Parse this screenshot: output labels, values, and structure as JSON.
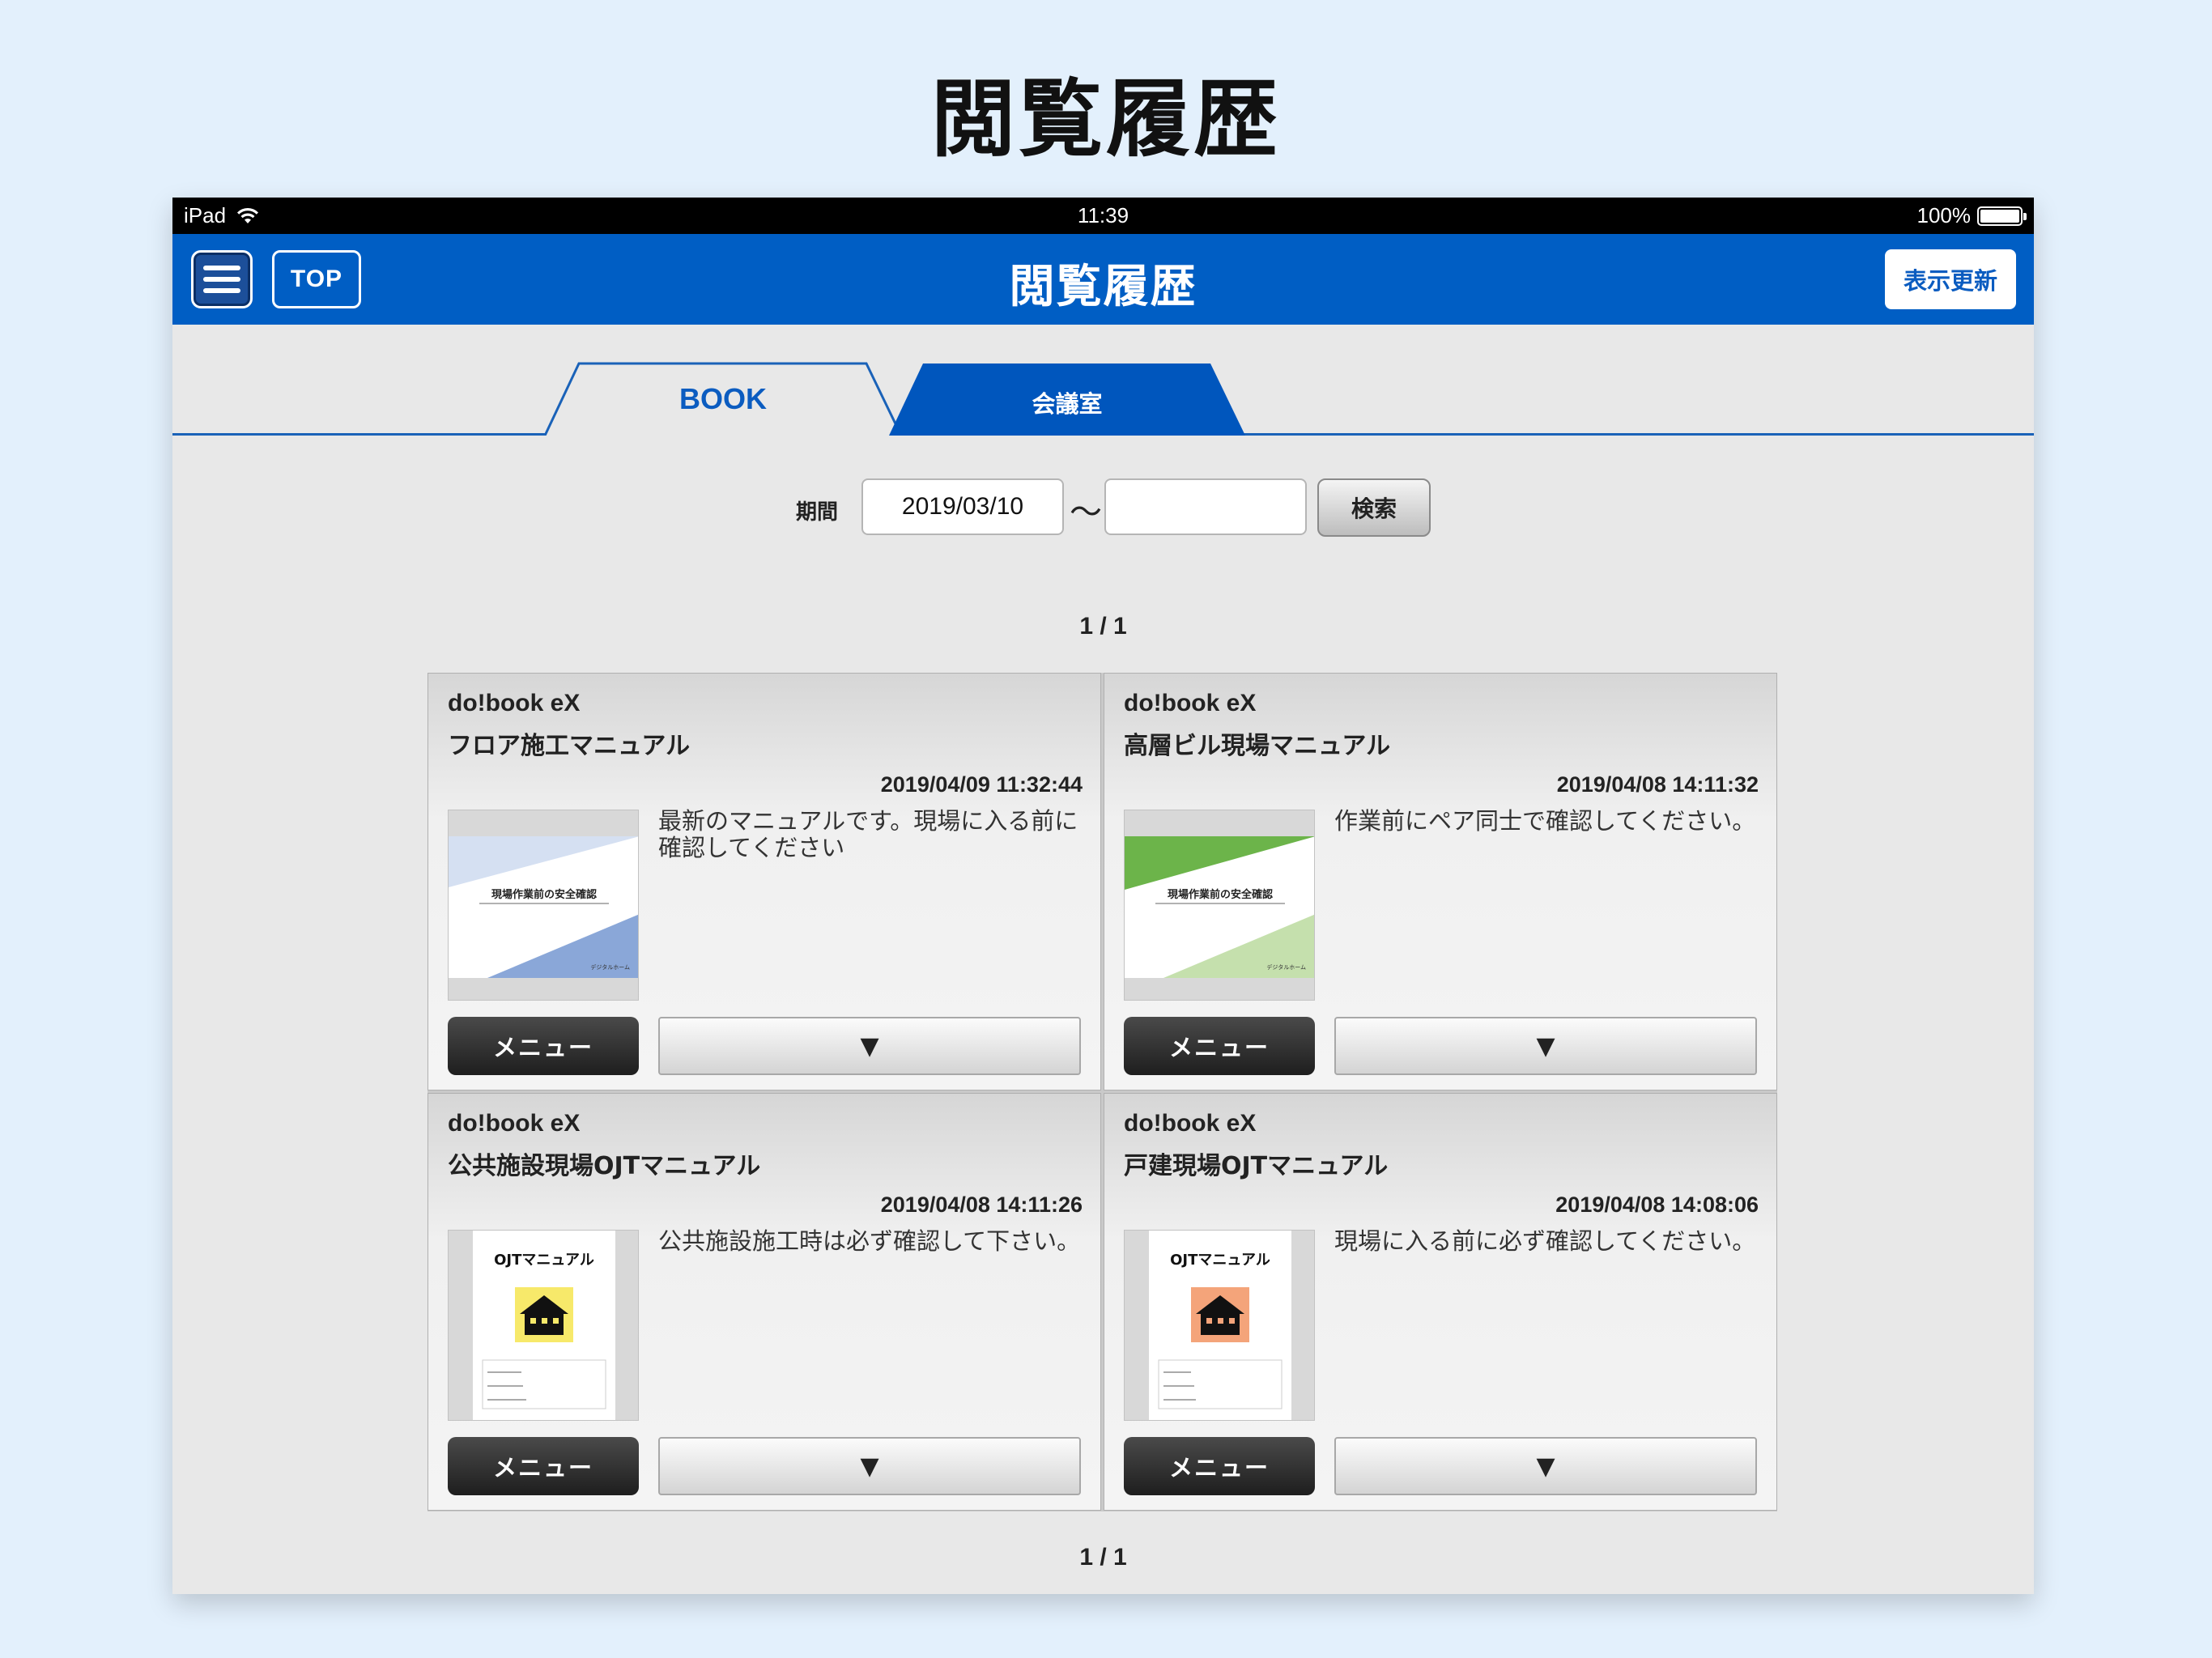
{
  "page_heading": "閲覧履歴",
  "status_bar": {
    "device": "iPad",
    "time": "11:39",
    "battery": "100%"
  },
  "nav": {
    "title": "閲覧履歴",
    "top_label": "TOP",
    "refresh_label": "表示更新"
  },
  "tabs": [
    {
      "label": "BOOK",
      "active": true
    },
    {
      "label": "会議室",
      "active": false
    }
  ],
  "search": {
    "period_label": "期間",
    "start_date": "2019/03/10",
    "end_date": "",
    "separator": "〜",
    "button_label": "検索"
  },
  "pager_top": "1 / 1",
  "pager_bottom": "1 / 1",
  "cards": [
    {
      "brand": "do!book eX",
      "title": "フロア施工マニュアル",
      "date": "2019/04/09 11:32:44",
      "description": "最新のマニュアルです。現場に入る前に確認してください",
      "thumb_title": "現場作業前の安全確認",
      "thumb_footer": "デジタルホーム",
      "thumb_accent": "#8aa7d8",
      "menu_label": "メニュー",
      "expand_label": "▼"
    },
    {
      "brand": "do!book eX",
      "title": "高層ビル現場マニュアル",
      "date": "2019/04/08 14:11:32",
      "description": "作業前にペア同士で確認してください。",
      "thumb_title": "現場作業前の安全確認",
      "thumb_footer": "デジタルホーム",
      "thumb_accent": "#6cb44a",
      "menu_label": "メニュー",
      "expand_label": "▼"
    },
    {
      "brand": "do!book eX",
      "title": "公共施設現場OJTマニュアル",
      "date": "2019/04/08 14:11:26",
      "description": "公共施設施工時は必ず確認して下さい。",
      "thumb_title": "OJTマニュアル",
      "thumb_accent": "#f7e96a",
      "menu_label": "メニュー",
      "expand_label": "▼"
    },
    {
      "brand": "do!book eX",
      "title": "戸建現場OJTマニュアル",
      "date": "2019/04/08 14:08:06",
      "description": "現場に入る前に必ず確認してください。",
      "thumb_title": "OJTマニュアル",
      "thumb_accent": "#f4a47a",
      "menu_label": "メニュー",
      "expand_label": "▼"
    }
  ]
}
